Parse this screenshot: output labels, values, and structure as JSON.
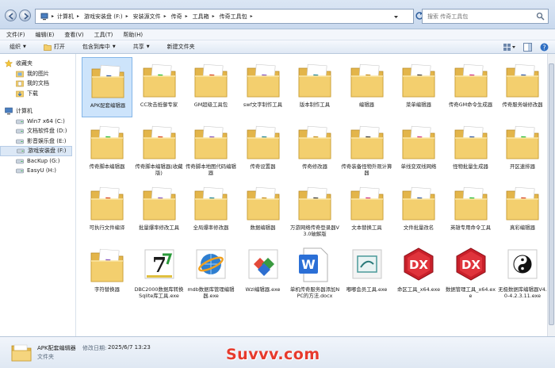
{
  "address": {
    "crumbs": [
      "计算机",
      "游戏安装盘 (F:)",
      "安装源文件",
      "传奇",
      "工具箱",
      "传奇工具包"
    ]
  },
  "search": {
    "placeholder": "搜索 传奇工具包"
  },
  "menu": [
    "文件(F)",
    "编辑(E)",
    "查看(V)",
    "工具(T)",
    "帮助(H)"
  ],
  "toolbar": {
    "organize": "组织",
    "open": "打开",
    "include": "包含到库中",
    "share": "共享",
    "new_folder": "新建文件夹"
  },
  "sidebar": {
    "favorites": "收藏夹",
    "favorites_items": [
      "我的图片",
      "我的文档",
      "下载"
    ],
    "computer": "计算机",
    "drives": [
      "Win7 x64 (C:)",
      "文档软件盘 (D:)",
      "影音娱乐盘 (E:)",
      "游戏安装盘 (F:)",
      "BacKup (G:)",
      "EasyU (H:)"
    ],
    "selected_drive_index": 3
  },
  "files": [
    {
      "label": "APK配套编辑器",
      "kind": "folder",
      "selected": true
    },
    {
      "label": "CC攻击抵御专家",
      "kind": "folder"
    },
    {
      "label": "GM超级工具包",
      "kind": "folder"
    },
    {
      "label": "swf文字制作工具",
      "kind": "folder"
    },
    {
      "label": "版本制作工具",
      "kind": "folder"
    },
    {
      "label": "编辑器",
      "kind": "folder"
    },
    {
      "label": "菜单编辑器",
      "kind": "folder"
    },
    {
      "label": "传奇GM命令生成器",
      "kind": "folder"
    },
    {
      "label": "传奇服务端修改器",
      "kind": "folder"
    },
    {
      "label": "传奇脚本编辑器",
      "kind": "folder"
    },
    {
      "label": "传奇脚本编辑器(收藏版)",
      "kind": "folder"
    },
    {
      "label": "传奇脚本地图代码编辑器",
      "kind": "folder"
    },
    {
      "label": "传奇设置器",
      "kind": "folder"
    },
    {
      "label": "传奇修改器",
      "kind": "folder"
    },
    {
      "label": "传奇装备怪物外观计算器",
      "kind": "folder"
    },
    {
      "label": "单线变双线网络",
      "kind": "folder"
    },
    {
      "label": "怪物批量生成器",
      "kind": "folder"
    },
    {
      "label": "开区速排器",
      "kind": "folder"
    },
    {
      "label": "可执行文件编译",
      "kind": "folder"
    },
    {
      "label": "批量爆率修改工具",
      "kind": "folder"
    },
    {
      "label": "全局爆率修改器",
      "kind": "folder"
    },
    {
      "label": "数据编辑器",
      "kind": "folder"
    },
    {
      "label": "万游网络传奇登录器V3.0破解版",
      "kind": "folder"
    },
    {
      "label": "文本替换工具",
      "kind": "folder"
    },
    {
      "label": "文件批量改名",
      "kind": "folder"
    },
    {
      "label": "英雄专用命令工具",
      "kind": "folder"
    },
    {
      "label": "真彩编辑器",
      "kind": "folder"
    },
    {
      "label": "字符替换器",
      "kind": "folder"
    },
    {
      "label": "DBC2000数据库转换Sqlite库工具.exe",
      "kind": "exe-7z"
    },
    {
      "label": "mdb数据库管理编辑器.exe",
      "kind": "exe-globe"
    },
    {
      "label": "Wzl编辑器.exe",
      "kind": "exe-cubes"
    },
    {
      "label": "单机传奇服务器添加NPC的方法.docx",
      "kind": "docx"
    },
    {
      "label": "嘟嘟会员工具.exe",
      "kind": "exe-box"
    },
    {
      "label": "命区工具_x64.exe",
      "kind": "exe-dx"
    },
    {
      "label": "数据管理工具_x64.exe",
      "kind": "exe-dx"
    },
    {
      "label": "无极数据库编辑器V4.0-4.2.3.11.exe",
      "kind": "exe-yinyang"
    }
  ],
  "details": {
    "name": "APK配套编辑器",
    "modified_label": "修改日期:",
    "modified_value": "2025/6/7 13:23",
    "type": "文件夹"
  },
  "watermark": "Suvvv.com",
  "colors": {
    "folder": "#f3cf6e",
    "dx_red": "#c8202a",
    "word_blue": "#2b6fd6",
    "watermark": "#e63a2c"
  }
}
